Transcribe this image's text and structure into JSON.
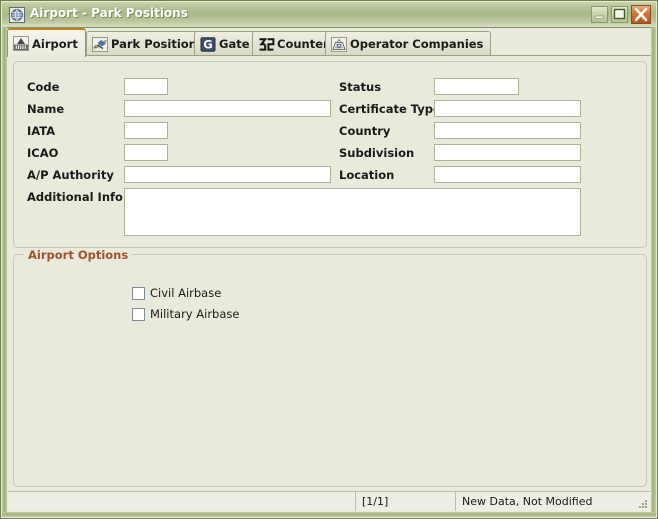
{
  "window": {
    "title": "Airport - Park Positions",
    "icon": "globe-document-icon",
    "controls": {
      "minimize": "Minimize",
      "maximize": "Maximize",
      "close": "Close"
    },
    "colors": {
      "titlebar": "#a9b98a",
      "frame": "#9fb07d",
      "panel_bg": "#eaeadc",
      "group_title": "#a0522d",
      "active_tab_accent": "#c87f22",
      "close_button": "#d4742f"
    }
  },
  "tabs": [
    {
      "label": "Airport",
      "icon": "airport-tower-icon",
      "active": true
    },
    {
      "label": "Park Positions",
      "icon": "park-positions-icon",
      "active": false
    },
    {
      "label": "Gate",
      "icon": "gate-letter-g-icon",
      "active": false
    },
    {
      "label": "Counter",
      "icon": "counter-digits-icon",
      "active": false
    },
    {
      "label": "Operator Companies",
      "icon": "operator-companies-icon",
      "active": false
    }
  ],
  "form": {
    "left_fields": [
      {
        "label": "Code",
        "value": "",
        "placeholder": ""
      },
      {
        "label": "Name",
        "value": "",
        "placeholder": ""
      },
      {
        "label": "IATA",
        "value": "",
        "placeholder": ""
      },
      {
        "label": "ICAO",
        "value": "",
        "placeholder": ""
      },
      {
        "label": "A/P Authority",
        "value": "",
        "placeholder": ""
      },
      {
        "label": "Additional Info",
        "value": "",
        "placeholder": ""
      }
    ],
    "right_fields": [
      {
        "label": "Status",
        "value": "",
        "placeholder": ""
      },
      {
        "label": "Certificate Type",
        "value": "",
        "placeholder": ""
      },
      {
        "label": "Country",
        "value": "",
        "placeholder": ""
      },
      {
        "label": "Subdivision",
        "value": "",
        "placeholder": ""
      },
      {
        "label": "Location",
        "value": "",
        "placeholder": ""
      }
    ]
  },
  "options": {
    "title": "Airport Options",
    "checkboxes": [
      {
        "label": "Civil Airbase",
        "checked": false
      },
      {
        "label": "Military Airbase",
        "checked": false
      }
    ]
  },
  "statusbar": {
    "left": "",
    "page": "[1/1]",
    "status": "New Data, Not Modified",
    "grip": "resize-grip-icon"
  }
}
